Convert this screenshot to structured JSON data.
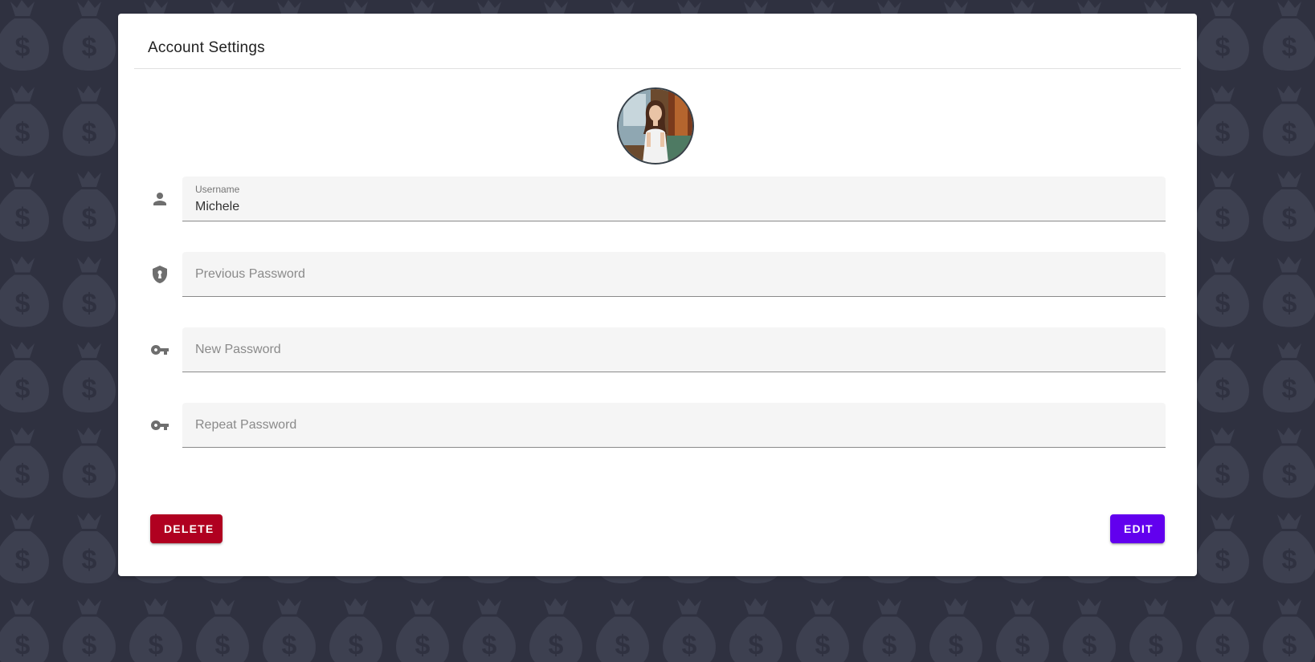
{
  "card": {
    "title": "Account Settings"
  },
  "form": {
    "username": {
      "label": "Username",
      "value": "Michele"
    },
    "previous_password": {
      "placeholder": "Previous Password"
    },
    "new_password": {
      "placeholder": "New Password"
    },
    "repeat_password": {
      "placeholder": "Repeat Password"
    }
  },
  "actions": {
    "delete_label": "DELETE",
    "edit_label": "EDIT"
  },
  "icons": {
    "background": "money-bag-icon",
    "username": "person-icon",
    "previous_password": "shield-lock-icon",
    "new_password": "key-icon",
    "repeat_password": "key-icon"
  },
  "colors": {
    "background": "#2f3140",
    "pattern": "#3d4050",
    "danger": "#b00020",
    "primary": "#6200ee",
    "icon": "#6e6e6e"
  }
}
